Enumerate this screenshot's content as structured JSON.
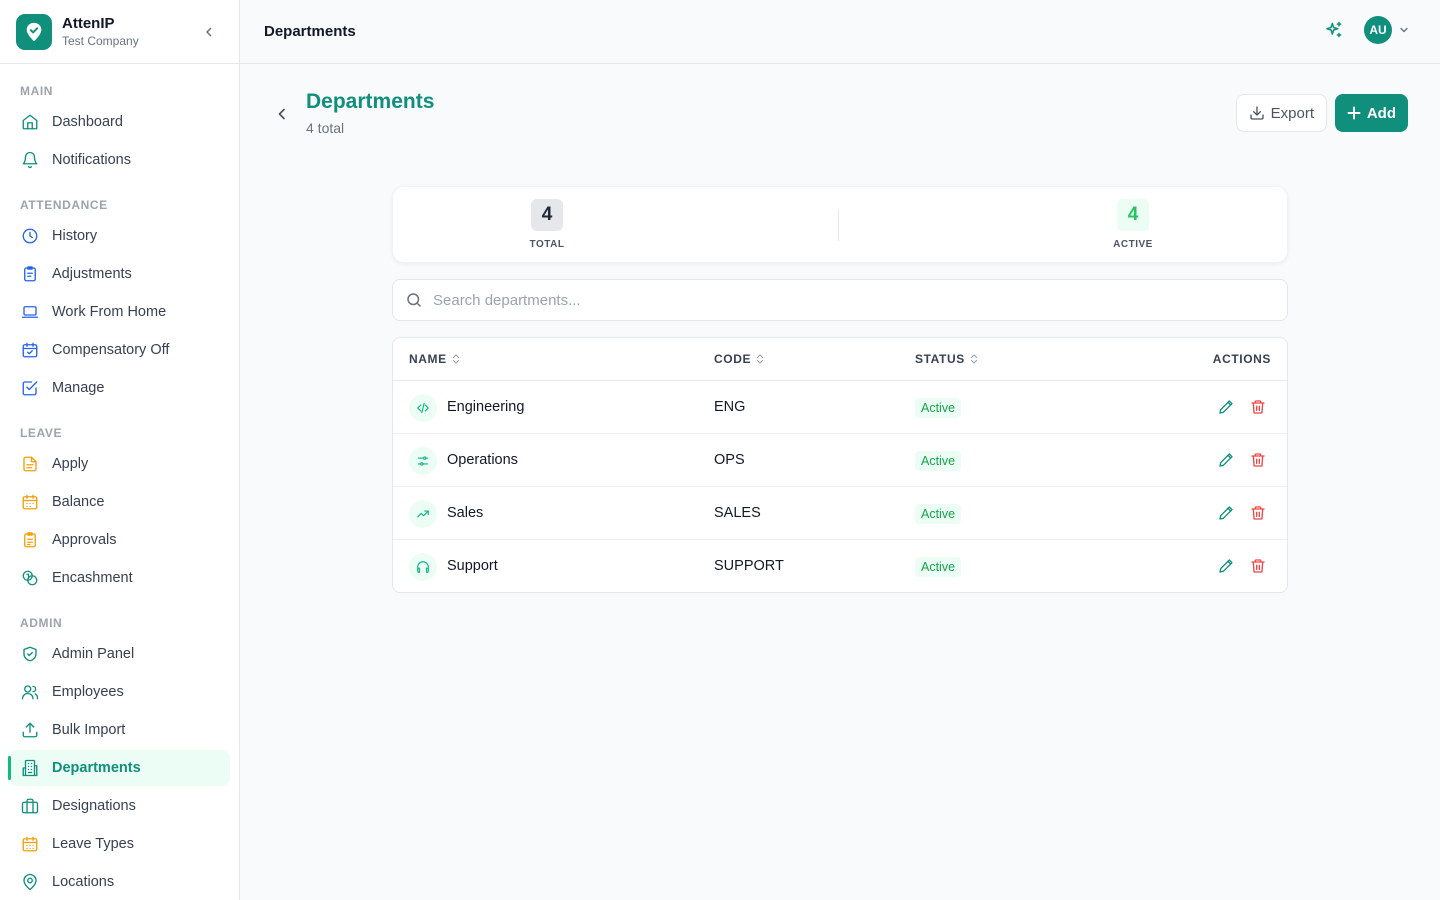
{
  "app": {
    "name": "AttenIP",
    "company": "Test Company"
  },
  "sidebar": {
    "sections": [
      {
        "title": "MAIN",
        "items": [
          {
            "label": "Dashboard",
            "icon": "home-icon"
          },
          {
            "label": "Notifications",
            "icon": "bell-icon"
          }
        ]
      },
      {
        "title": "ATTENDANCE",
        "items": [
          {
            "label": "History",
            "icon": "clock-icon"
          },
          {
            "label": "Adjustments",
            "icon": "clipboard-icon"
          },
          {
            "label": "Work From Home",
            "icon": "laptop-icon"
          },
          {
            "label": "Compensatory Off",
            "icon": "calendar-check-icon"
          },
          {
            "label": "Manage",
            "icon": "square-check-icon"
          }
        ]
      },
      {
        "title": "LEAVE",
        "items": [
          {
            "label": "Apply",
            "icon": "file-text-icon"
          },
          {
            "label": "Balance",
            "icon": "calendar-grid-icon"
          },
          {
            "label": "Approvals",
            "icon": "clipboard-list-icon"
          },
          {
            "label": "Encashment",
            "icon": "coins-icon"
          }
        ]
      },
      {
        "title": "ADMIN",
        "items": [
          {
            "label": "Admin Panel",
            "icon": "shield-check-icon"
          },
          {
            "label": "Employees",
            "icon": "users-icon"
          },
          {
            "label": "Bulk Import",
            "icon": "upload-icon"
          },
          {
            "label": "Departments",
            "icon": "building-icon",
            "active": true
          },
          {
            "label": "Designations",
            "icon": "briefcase-icon"
          },
          {
            "label": "Leave Types",
            "icon": "calendar-days-icon"
          },
          {
            "label": "Locations",
            "icon": "map-pin-icon"
          }
        ]
      }
    ]
  },
  "header": {
    "title": "Departments",
    "avatar_initials": "AU"
  },
  "page": {
    "title": "Departments",
    "subtitle": "4 total",
    "export_label": "Export",
    "add_label": "Add"
  },
  "stats": {
    "total": {
      "value": "4",
      "label": "TOTAL"
    },
    "active": {
      "value": "4",
      "label": "ACTIVE"
    }
  },
  "search": {
    "placeholder": "Search departments...",
    "value": ""
  },
  "table": {
    "headers": {
      "name": "NAME",
      "code": "CODE",
      "status": "STATUS",
      "actions": "ACTIONS"
    },
    "rows": [
      {
        "name": "Engineering",
        "code": "ENG",
        "status": "Active",
        "icon": "code-icon"
      },
      {
        "name": "Operations",
        "code": "OPS",
        "status": "Active",
        "icon": "sliders-icon"
      },
      {
        "name": "Sales",
        "code": "SALES",
        "status": "Active",
        "icon": "trending-up-icon"
      },
      {
        "name": "Support",
        "code": "SUPPORT",
        "status": "Active",
        "icon": "headphones-icon"
      }
    ]
  },
  "colors": {
    "brand": "#0f8f7c",
    "active_green": "#16a34a",
    "attendance_icon": "#2563eb",
    "leave_icon": "#f59e0b",
    "delete_red": "#ef4444"
  }
}
